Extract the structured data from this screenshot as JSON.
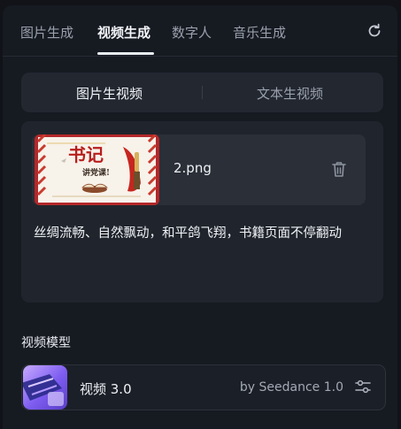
{
  "tabs": [
    {
      "label": "图片生成",
      "active": false
    },
    {
      "label": "视频生成",
      "active": true
    },
    {
      "label": "数字人",
      "active": false
    },
    {
      "label": "音乐生成",
      "active": false
    }
  ],
  "header": {
    "refresh_icon": "refresh-icon"
  },
  "mode": {
    "options": [
      "图片生视频",
      "文本生视频"
    ],
    "selected": "图片生视频"
  },
  "upload": {
    "file_name": "2.png",
    "thumbnail_text": {
      "calligraphy": "书记",
      "subtitle": "讲党课!"
    },
    "delete_icon": "trash-icon"
  },
  "prompt": {
    "text": "丝绸流畅、自然飘动，和平鸽飞翔，书籍页面不停翻动"
  },
  "model_section": {
    "title": "视频模型",
    "model_name": "视频 3.0",
    "provider": "by Seedance 1.0",
    "settings_icon": "sliders-icon"
  },
  "colors": {
    "background": "#111318",
    "panel": "#161a21",
    "card": "#20252d",
    "text_primary": "#f2f4f8",
    "text_secondary": "#9aa1ad"
  }
}
